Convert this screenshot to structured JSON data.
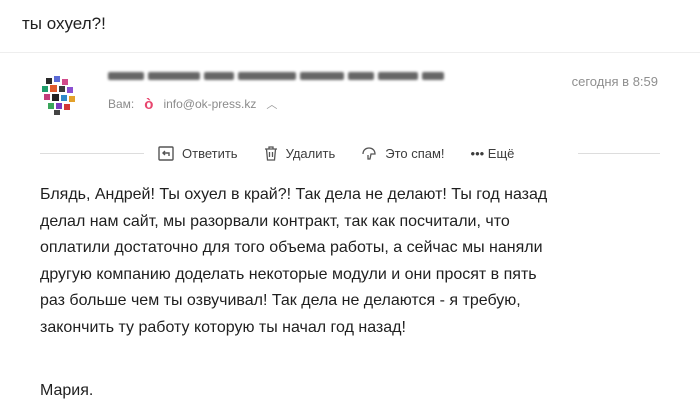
{
  "subject": "ты охуел?!",
  "sender": {
    "recipient_label": "Вам:",
    "recipient_email": "info@ok-press.kz",
    "date": "сегодня в 8:59"
  },
  "toolbar": {
    "reply": "Ответить",
    "delete": "Удалить",
    "spam": "Это спам!",
    "more": "••• Ещё"
  },
  "body": {
    "lines": [
      "Блядь, Андрей! Ты охуел в край?! Так дела не делают! Ты год назад",
      "делал нам сайт, мы разорвали контракт, так как посчитали, что",
      "оплатили достаточно для того объема работы, а сейчас мы наняли",
      "другую компанию доделать некоторые модули и они просят в пять",
      "раз больше чем ты озвучивал! Так дела не делаются - я требую,",
      "закончить ту работу которую ты начал год назад!"
    ],
    "signature": "Мария."
  },
  "colors": {
    "accent_pink": "#e8466e",
    "muted_text": "#8b8b8b"
  },
  "icons": {
    "reply": "reply-icon",
    "delete": "trash-icon",
    "spam": "thumb-down-icon",
    "recipient": "ok-logo-icon",
    "expand": "chevron-up-icon"
  }
}
